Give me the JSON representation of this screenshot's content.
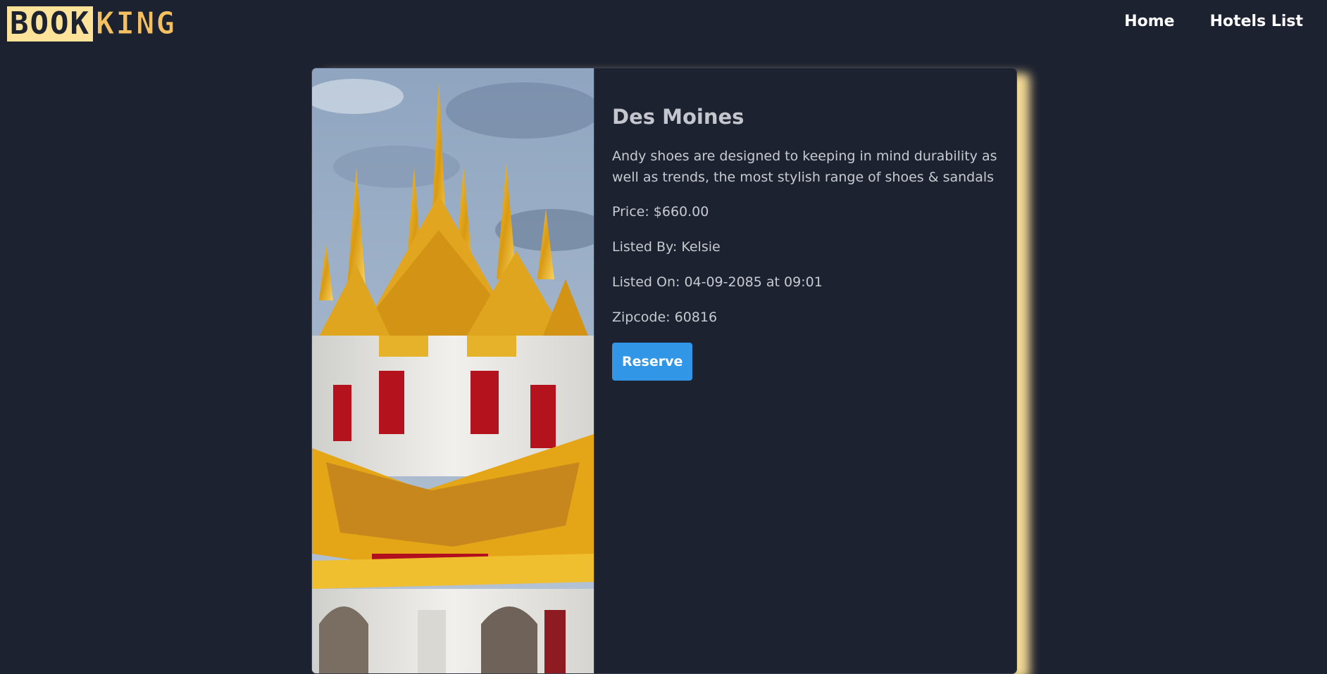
{
  "brand": {
    "logo_part1": "BOOK",
    "logo_part2": "KING"
  },
  "nav": {
    "items": [
      {
        "label": "Home"
      },
      {
        "label": "Hotels List"
      }
    ]
  },
  "hotel": {
    "name": "Des Moines",
    "description": "Andy shoes are designed to keeping in mind durability as well as trends, the most stylish range of shoes & sandals",
    "price": "Price: $660.00",
    "listed_by": "Listed By: Kelsie",
    "listed_on": "Listed On: 04-09-2085 at 09:01",
    "zipcode": "Zipcode: 60816",
    "reserve_label": "Reserve",
    "image_icon": "temple-photo"
  },
  "colors": {
    "background": "#1d2230",
    "accent_glow": "#fde29a",
    "button": "#3196e6",
    "logo_gold": "#f4c060"
  }
}
